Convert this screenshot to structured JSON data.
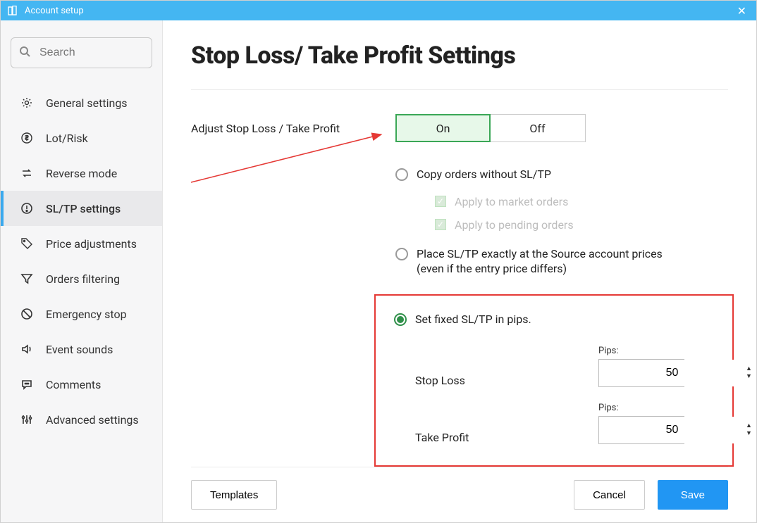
{
  "window": {
    "title": "Account setup"
  },
  "search": {
    "placeholder": "Search"
  },
  "sidebar": {
    "items": [
      {
        "label": "General settings"
      },
      {
        "label": "Lot/Risk"
      },
      {
        "label": "Reverse mode"
      },
      {
        "label": "SL/TP settings"
      },
      {
        "label": "Price adjustments"
      },
      {
        "label": "Orders filtering"
      },
      {
        "label": "Emergency stop"
      },
      {
        "label": "Event sounds"
      },
      {
        "label": "Comments"
      },
      {
        "label": "Advanced settings"
      }
    ]
  },
  "main": {
    "title": "Stop Loss/ Take Profit Settings",
    "adjust_label": "Adjust Stop Loss / Take Profit",
    "toggle": {
      "on": "On",
      "off": "Off",
      "value": "On"
    },
    "options": {
      "copy": "Copy orders without SL/TP",
      "copy_sub1": "Apply to market orders",
      "copy_sub2": "Apply to pending orders",
      "place_line1": "Place SL/TP exactly at the Source account prices",
      "place_line2": "(even if the entry price differs)",
      "fixed": "Set fixed SL/TP in pips."
    },
    "fixed": {
      "stop_loss_label": "Stop Loss",
      "take_profit_label": "Take Profit",
      "pips_label": "Pips:",
      "sl_value": "50",
      "tp_value": "50"
    }
  },
  "footer": {
    "templates": "Templates",
    "cancel": "Cancel",
    "save": "Save"
  }
}
